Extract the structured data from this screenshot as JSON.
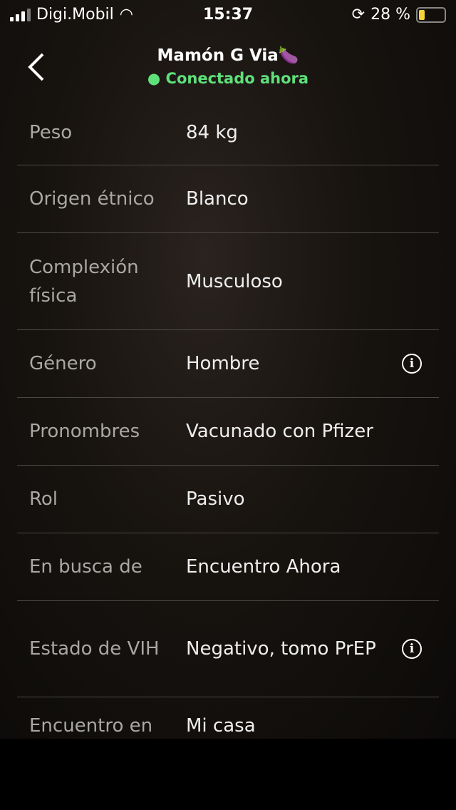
{
  "status": {
    "carrier": "Digi.Mobil",
    "time": "15:37",
    "battery": "28 %",
    "battery_level": 28
  },
  "header": {
    "title": "Mamón G Via🍆",
    "status": "● Conectado ahora",
    "status_color": "#5ee07a"
  },
  "rows": [
    {
      "key": "Peso",
      "value": "84 kg",
      "h": 90
    },
    {
      "key": "Origen étnico",
      "value": "Blanco",
      "h": 94
    },
    {
      "key": "Complexión física",
      "value": "Musculoso",
      "h": 135
    },
    {
      "key": "Género",
      "value": "Hombre",
      "h": 94,
      "info": true
    },
    {
      "key": "Pronombres",
      "value": "Vacunado con Pfizer",
      "h": 94
    },
    {
      "key": "Rol",
      "value": "Pasivo",
      "h": 94
    },
    {
      "key": "En busca de",
      "value": "Encuentro Ahora",
      "h": 94
    },
    {
      "key": "Estado de VIH",
      "value": "Negativo, tomo PrEP",
      "h": 134,
      "info": true
    },
    {
      "key": "Encuentro en",
      "value": "Mi casa",
      "h": 80
    }
  ]
}
